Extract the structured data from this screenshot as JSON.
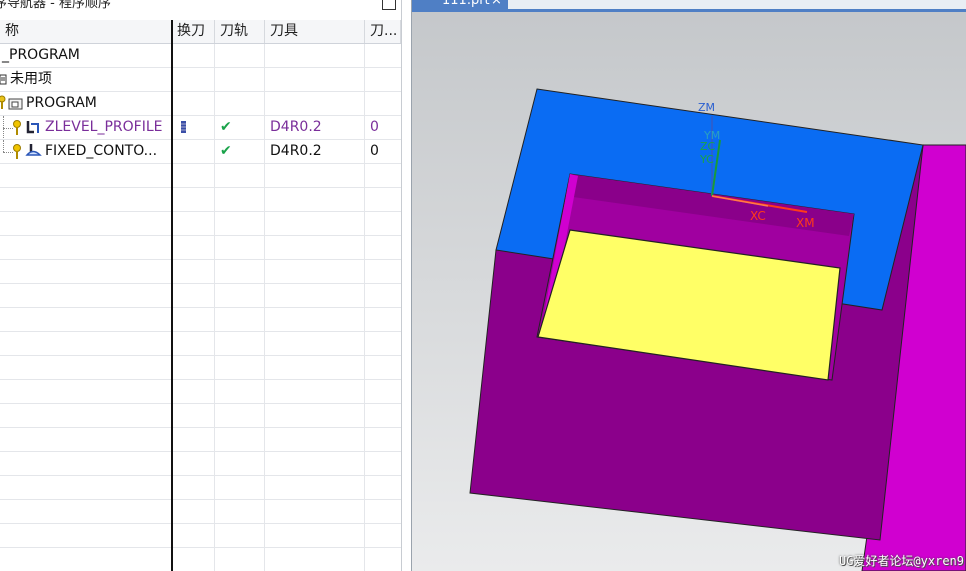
{
  "navigator": {
    "title": "序导航器 - 程序顺序",
    "columns": {
      "name": "称",
      "tool_change": "换刀",
      "toolpath": "刀轨",
      "tool": "刀具",
      "tool_num": "刀..."
    },
    "rows": [
      {
        "name": "_PROGRAM",
        "tool_change": "",
        "toolpath": "",
        "tool": "",
        "tool_num": ""
      },
      {
        "name": "未用项",
        "tool_change": "",
        "toolpath": "",
        "tool": "",
        "tool_num": ""
      },
      {
        "name": "PROGRAM",
        "tool_change": "",
        "toolpath": "",
        "tool": "",
        "tool_num": ""
      },
      {
        "name": "ZLEVEL_PROFILE",
        "tool_change": "",
        "toolpath": "✔",
        "tool": "D4R0.2",
        "tool_num": "0",
        "selected": true
      },
      {
        "name": "FIXED_CONTO...",
        "tool_change": "",
        "toolpath": "✔",
        "tool": "D4R0.2",
        "tool_num": "0"
      }
    ]
  },
  "graphics": {
    "tab_label": "111.prt",
    "tab_close": "×",
    "axes": {
      "zm": "ZM",
      "ym": "YM",
      "yc": "YC",
      "zc": "ZC",
      "xc": "XC",
      "xm": "XM"
    },
    "watermark": "UG爱好者论坛@yxren9",
    "colors": {
      "top_face": "#0a6cf3",
      "side_face": "#8f008f",
      "pocket_floor": "#ffff66",
      "background_top": "#c9cccf",
      "background_bottom": "#e8e9ea",
      "check": "#1aa34a",
      "selected_text": "#7a2e9a"
    }
  }
}
